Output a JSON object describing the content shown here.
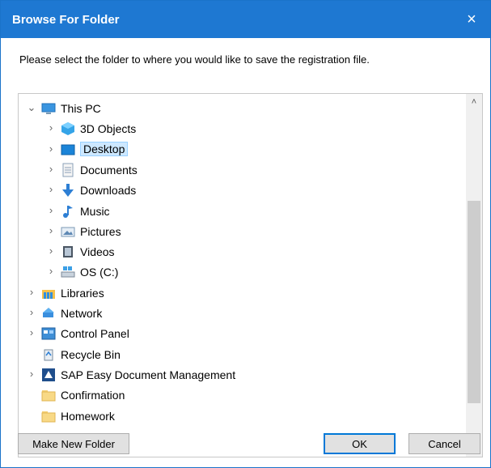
{
  "window": {
    "title": "Browse For Folder",
    "close_icon": "×"
  },
  "instruction": "Please select the folder to where you would like to save the registration file.",
  "tree": {
    "expanded_chevron": "⌄",
    "collapsed_chevron": "›",
    "items": [
      {
        "label": "This PC",
        "icon": "this-pc-icon",
        "chevron": "expanded",
        "selected": false
      },
      {
        "label": "3D Objects",
        "icon": "3d-objects-icon",
        "chevron": "collapsed",
        "selected": false
      },
      {
        "label": "Desktop",
        "icon": "desktop-icon",
        "chevron": "collapsed",
        "selected": true
      },
      {
        "label": "Documents",
        "icon": "documents-icon",
        "chevron": "collapsed",
        "selected": false
      },
      {
        "label": "Downloads",
        "icon": "downloads-icon",
        "chevron": "collapsed",
        "selected": false
      },
      {
        "label": "Music",
        "icon": "music-icon",
        "chevron": "collapsed",
        "selected": false
      },
      {
        "label": "Pictures",
        "icon": "pictures-icon",
        "chevron": "collapsed",
        "selected": false
      },
      {
        "label": "Videos",
        "icon": "videos-icon",
        "chevron": "collapsed",
        "selected": false
      },
      {
        "label": "OS (C:)",
        "icon": "drive-icon",
        "chevron": "collapsed",
        "selected": false
      },
      {
        "label": "Libraries",
        "icon": "libraries-icon",
        "chevron": "collapsed",
        "selected": false
      },
      {
        "label": "Network",
        "icon": "network-icon",
        "chevron": "collapsed",
        "selected": false
      },
      {
        "label": "Control Panel",
        "icon": "control-panel-icon",
        "chevron": "collapsed",
        "selected": false
      },
      {
        "label": "Recycle Bin",
        "icon": "recycle-bin-icon",
        "chevron": "none",
        "selected": false
      },
      {
        "label": "SAP Easy Document Management",
        "icon": "sap-icon",
        "chevron": "collapsed",
        "selected": false
      },
      {
        "label": "Confirmation",
        "icon": "folder-icon",
        "chevron": "none",
        "selected": false
      },
      {
        "label": "Homework",
        "icon": "folder-icon",
        "chevron": "none",
        "selected": false
      }
    ],
    "scroll_up_icon": "˄",
    "scroll_down_icon": "˅"
  },
  "buttons": {
    "make_new_folder": "Make New Folder",
    "ok": "OK",
    "cancel": "Cancel"
  },
  "colors": {
    "titlebar": "#1e78d2",
    "selection_bg": "#cde8ff",
    "selection_border": "#99d1ff",
    "default_button_border": "#0078d7"
  }
}
